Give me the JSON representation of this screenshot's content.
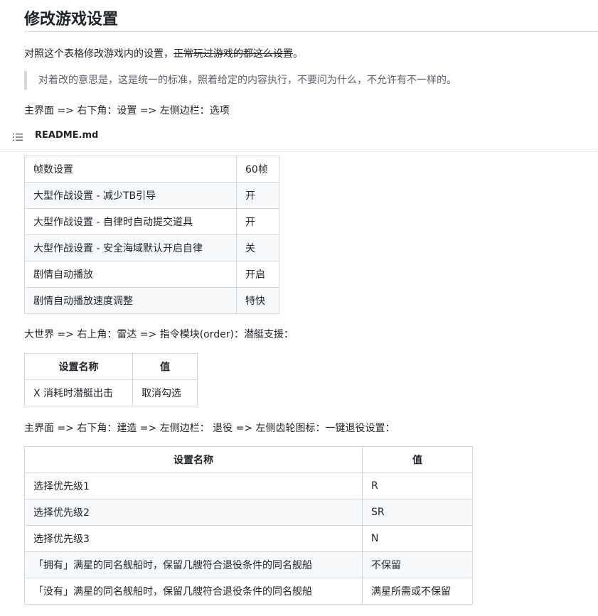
{
  "title": "修改游戏设置",
  "intro": {
    "text_a": "对照这个表格修改游戏内的设置，",
    "text_strike": "正常玩过游戏的都这么设置",
    "text_b": "。"
  },
  "quote": "对着改的意思是，这是统一的标准，照着给定的内容执行，不要问为什么，不允许有不一样的。",
  "path1": "主界面 => 右下角：设置 => 左侧边栏：选项",
  "sticky_header": {
    "icon": "list-icon",
    "filename": "README.md"
  },
  "table1": {
    "rows": [
      {
        "name": "帧数设置",
        "value": "60帧"
      },
      {
        "name": "大型作战设置 - 减少TB引导",
        "value": "开"
      },
      {
        "name": "大型作战设置 - 自律时自动提交道具",
        "value": "开"
      },
      {
        "name": "大型作战设置 - 安全海域默认开启自律",
        "value": "关"
      },
      {
        "name": "剧情自动播放",
        "value": "开启"
      },
      {
        "name": "剧情自动播放速度调整",
        "value": "特快"
      }
    ]
  },
  "path2": "大世界 => 右上角：雷达 => 指令模块(order)：潜艇支援：",
  "table2": {
    "headers": [
      "设置名称",
      "值"
    ],
    "rows": [
      {
        "name": "X 消耗时潜艇出击",
        "value": "取消勾选"
      }
    ]
  },
  "path3": "主界面 => 右下角：建造 => 左侧边栏： 退役 => 左侧齿轮图标：一键退役设置：",
  "table3": {
    "headers": [
      "设置名称",
      "值"
    ],
    "rows": [
      {
        "name": "选择优先级1",
        "value": "R"
      },
      {
        "name": "选择优先级2",
        "value": "SR"
      },
      {
        "name": "选择优先级3",
        "value": "N"
      },
      {
        "name": "「拥有」满星的同名舰船时，保留几艘符合退役条件的同名舰船",
        "value": "不保留"
      },
      {
        "name": "「没有」满星的同名舰船时，保留几艘符合退役条件的同名舰船",
        "value": "满星所需或不保留"
      }
    ]
  }
}
